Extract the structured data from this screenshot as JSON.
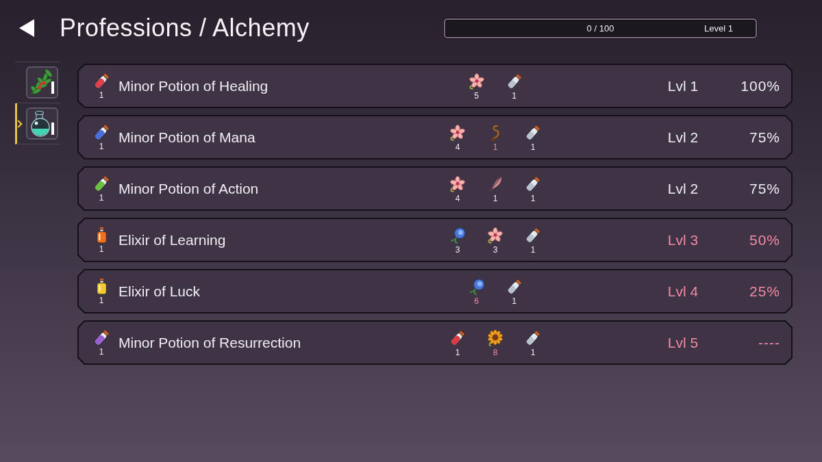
{
  "header": {
    "title": "Professions / Alchemy",
    "experience": {
      "value": "0 / 100",
      "level_label": "Level 1",
      "level": 0
    }
  },
  "sidebar": {
    "tabs": [
      {
        "kind": "herb",
        "selected": false
      },
      {
        "kind": "flask",
        "selected": true
      }
    ]
  },
  "recipes": [
    {
      "potion": {
        "kind": "vial",
        "color": "#e0404a",
        "count": "1"
      },
      "name": "Minor Potion of Healing",
      "ingredients": [
        {
          "kind": "lily",
          "count": "5",
          "missing": false
        },
        {
          "kind": "empty-vial",
          "count": "1",
          "missing": false
        }
      ],
      "required_level": "Lvl 1",
      "chance": "100%",
      "locked": false
    },
    {
      "potion": {
        "kind": "vial",
        "color": "#4a6ee0",
        "count": "1"
      },
      "name": "Minor Potion of Mana",
      "ingredients": [
        {
          "kind": "lily",
          "count": "4",
          "missing": false
        },
        {
          "kind": "root",
          "count": "1",
          "missing": true
        },
        {
          "kind": "empty-vial",
          "count": "1",
          "missing": false
        }
      ],
      "required_level": "Lvl 2",
      "chance": "75%",
      "locked": false
    },
    {
      "potion": {
        "kind": "vial",
        "color": "#6cc040",
        "count": "1"
      },
      "name": "Minor Potion of Action",
      "ingredients": [
        {
          "kind": "lily",
          "count": "4",
          "missing": false
        },
        {
          "kind": "feather",
          "count": "1",
          "missing": false
        },
        {
          "kind": "empty-vial",
          "count": "1",
          "missing": false
        }
      ],
      "required_level": "Lvl 2",
      "chance": "75%",
      "locked": false
    },
    {
      "potion": {
        "kind": "bottle",
        "color": "#f07020",
        "count": "1"
      },
      "name": "Elixir of Learning",
      "ingredients": [
        {
          "kind": "bluebell",
          "count": "3",
          "missing": false
        },
        {
          "kind": "lily",
          "count": "3",
          "missing": false
        },
        {
          "kind": "empty-vial",
          "count": "1",
          "missing": false
        }
      ],
      "required_level": "Lvl 3",
      "chance": "50%",
      "locked": true
    },
    {
      "potion": {
        "kind": "bottle",
        "color": "#f0c830",
        "count": "1"
      },
      "name": "Elixir of Luck",
      "ingredients": [
        {
          "kind": "bluebell",
          "count": "6",
          "missing": true
        },
        {
          "kind": "empty-vial",
          "count": "1",
          "missing": false
        }
      ],
      "required_level": "Lvl 4",
      "chance": "25%",
      "locked": true
    },
    {
      "potion": {
        "kind": "vial",
        "color": "#9a60d8",
        "count": "1"
      },
      "name": "Minor Potion of Resurrection",
      "ingredients": [
        {
          "kind": "red-vial",
          "count": "1",
          "missing": false
        },
        {
          "kind": "sunflower",
          "count": "8",
          "missing": true
        },
        {
          "kind": "empty-vial",
          "count": "1",
          "missing": false
        }
      ],
      "required_level": "Lvl 5",
      "chance": "----",
      "locked": true
    }
  ]
}
